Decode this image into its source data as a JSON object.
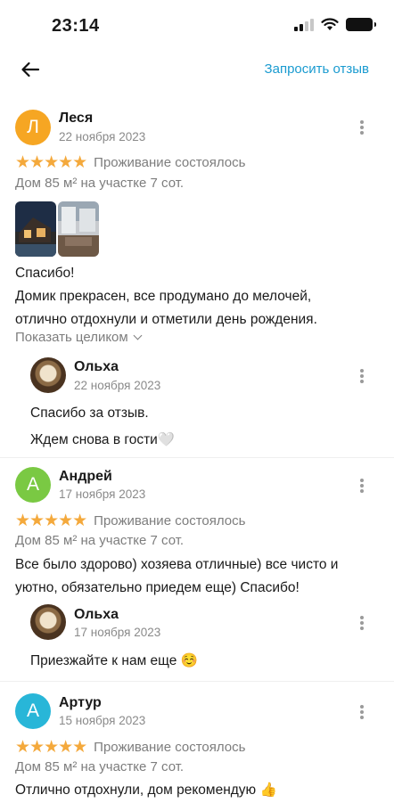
{
  "status_bar": {
    "time": "23:14"
  },
  "header": {
    "request_review": "Запросить отзыв"
  },
  "reviews": [
    {
      "initial": "Л",
      "avatar_color": "#f6a623",
      "author": "Леся",
      "date": "22 ноября 2023",
      "stars": "★★★★★",
      "stay_status": "Проживание состоялось",
      "listing": "Дом 85 м² на участке 7 сот.",
      "text_lines": [
        "Спасибо!",
        "Домик прекрасен, все продумано до мелочей,",
        "отлично отдохнули и отметили день рождения."
      ],
      "expand_label": "Показать целиком",
      "reply": {
        "author": "Ольха",
        "date": "22 ноября 2023",
        "text_lines": [
          "Спасибо за отзыв.",
          "Ждем снова в гости🤍"
        ]
      }
    },
    {
      "initial": "А",
      "avatar_color": "#7ac943",
      "author": "Андрей",
      "date": "17 ноября 2023",
      "stars": "★★★★★",
      "stay_status": "Проживание состоялось",
      "listing": "Дом 85 м² на участке 7 сот.",
      "text_lines": [
        "Все было здорово) хозяева отличные) все чисто и",
        "уютно, обязательно приедем еще) Спасибо!"
      ],
      "reply": {
        "author": "Ольха",
        "date": "17 ноября 2023",
        "text_lines": [
          "Приезжайте к нам еще ☺️"
        ]
      }
    },
    {
      "initial": "А",
      "avatar_color": "#28b6d8",
      "author": "Артур",
      "date": "15 ноября 2023",
      "stars": "★★★★★",
      "stay_status": "Проживание состоялось",
      "listing": "Дом 85 м² на участке 7 сот.",
      "text_lines": [
        "Отлично отдохнули, дом рекомендую 👍"
      ]
    }
  ]
}
